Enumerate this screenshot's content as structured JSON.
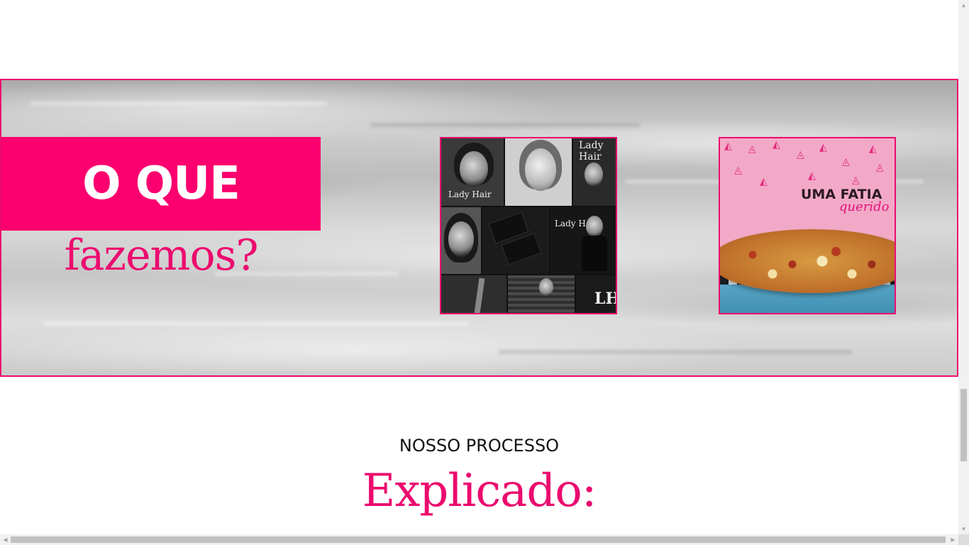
{
  "hero": {
    "title_main": "O QUE",
    "title_sub": "fazemos?",
    "accent_color": "#fb006e",
    "border_color": "#ec0a6e"
  },
  "portfolio": [
    {
      "name": "lady-hair-collage",
      "label": "Lady Hair",
      "logo_mark": "LH"
    },
    {
      "name": "pizza-campaign",
      "headline": "UMA FATIA",
      "script": "querido"
    }
  ],
  "process": {
    "kicker": "NOSSO PROCESSO",
    "title": "Explicado:"
  },
  "icons": {
    "scroll_up": "arrow-up",
    "scroll_down": "arrow-down",
    "scroll_left": "arrow-left",
    "scroll_right": "arrow-right"
  }
}
